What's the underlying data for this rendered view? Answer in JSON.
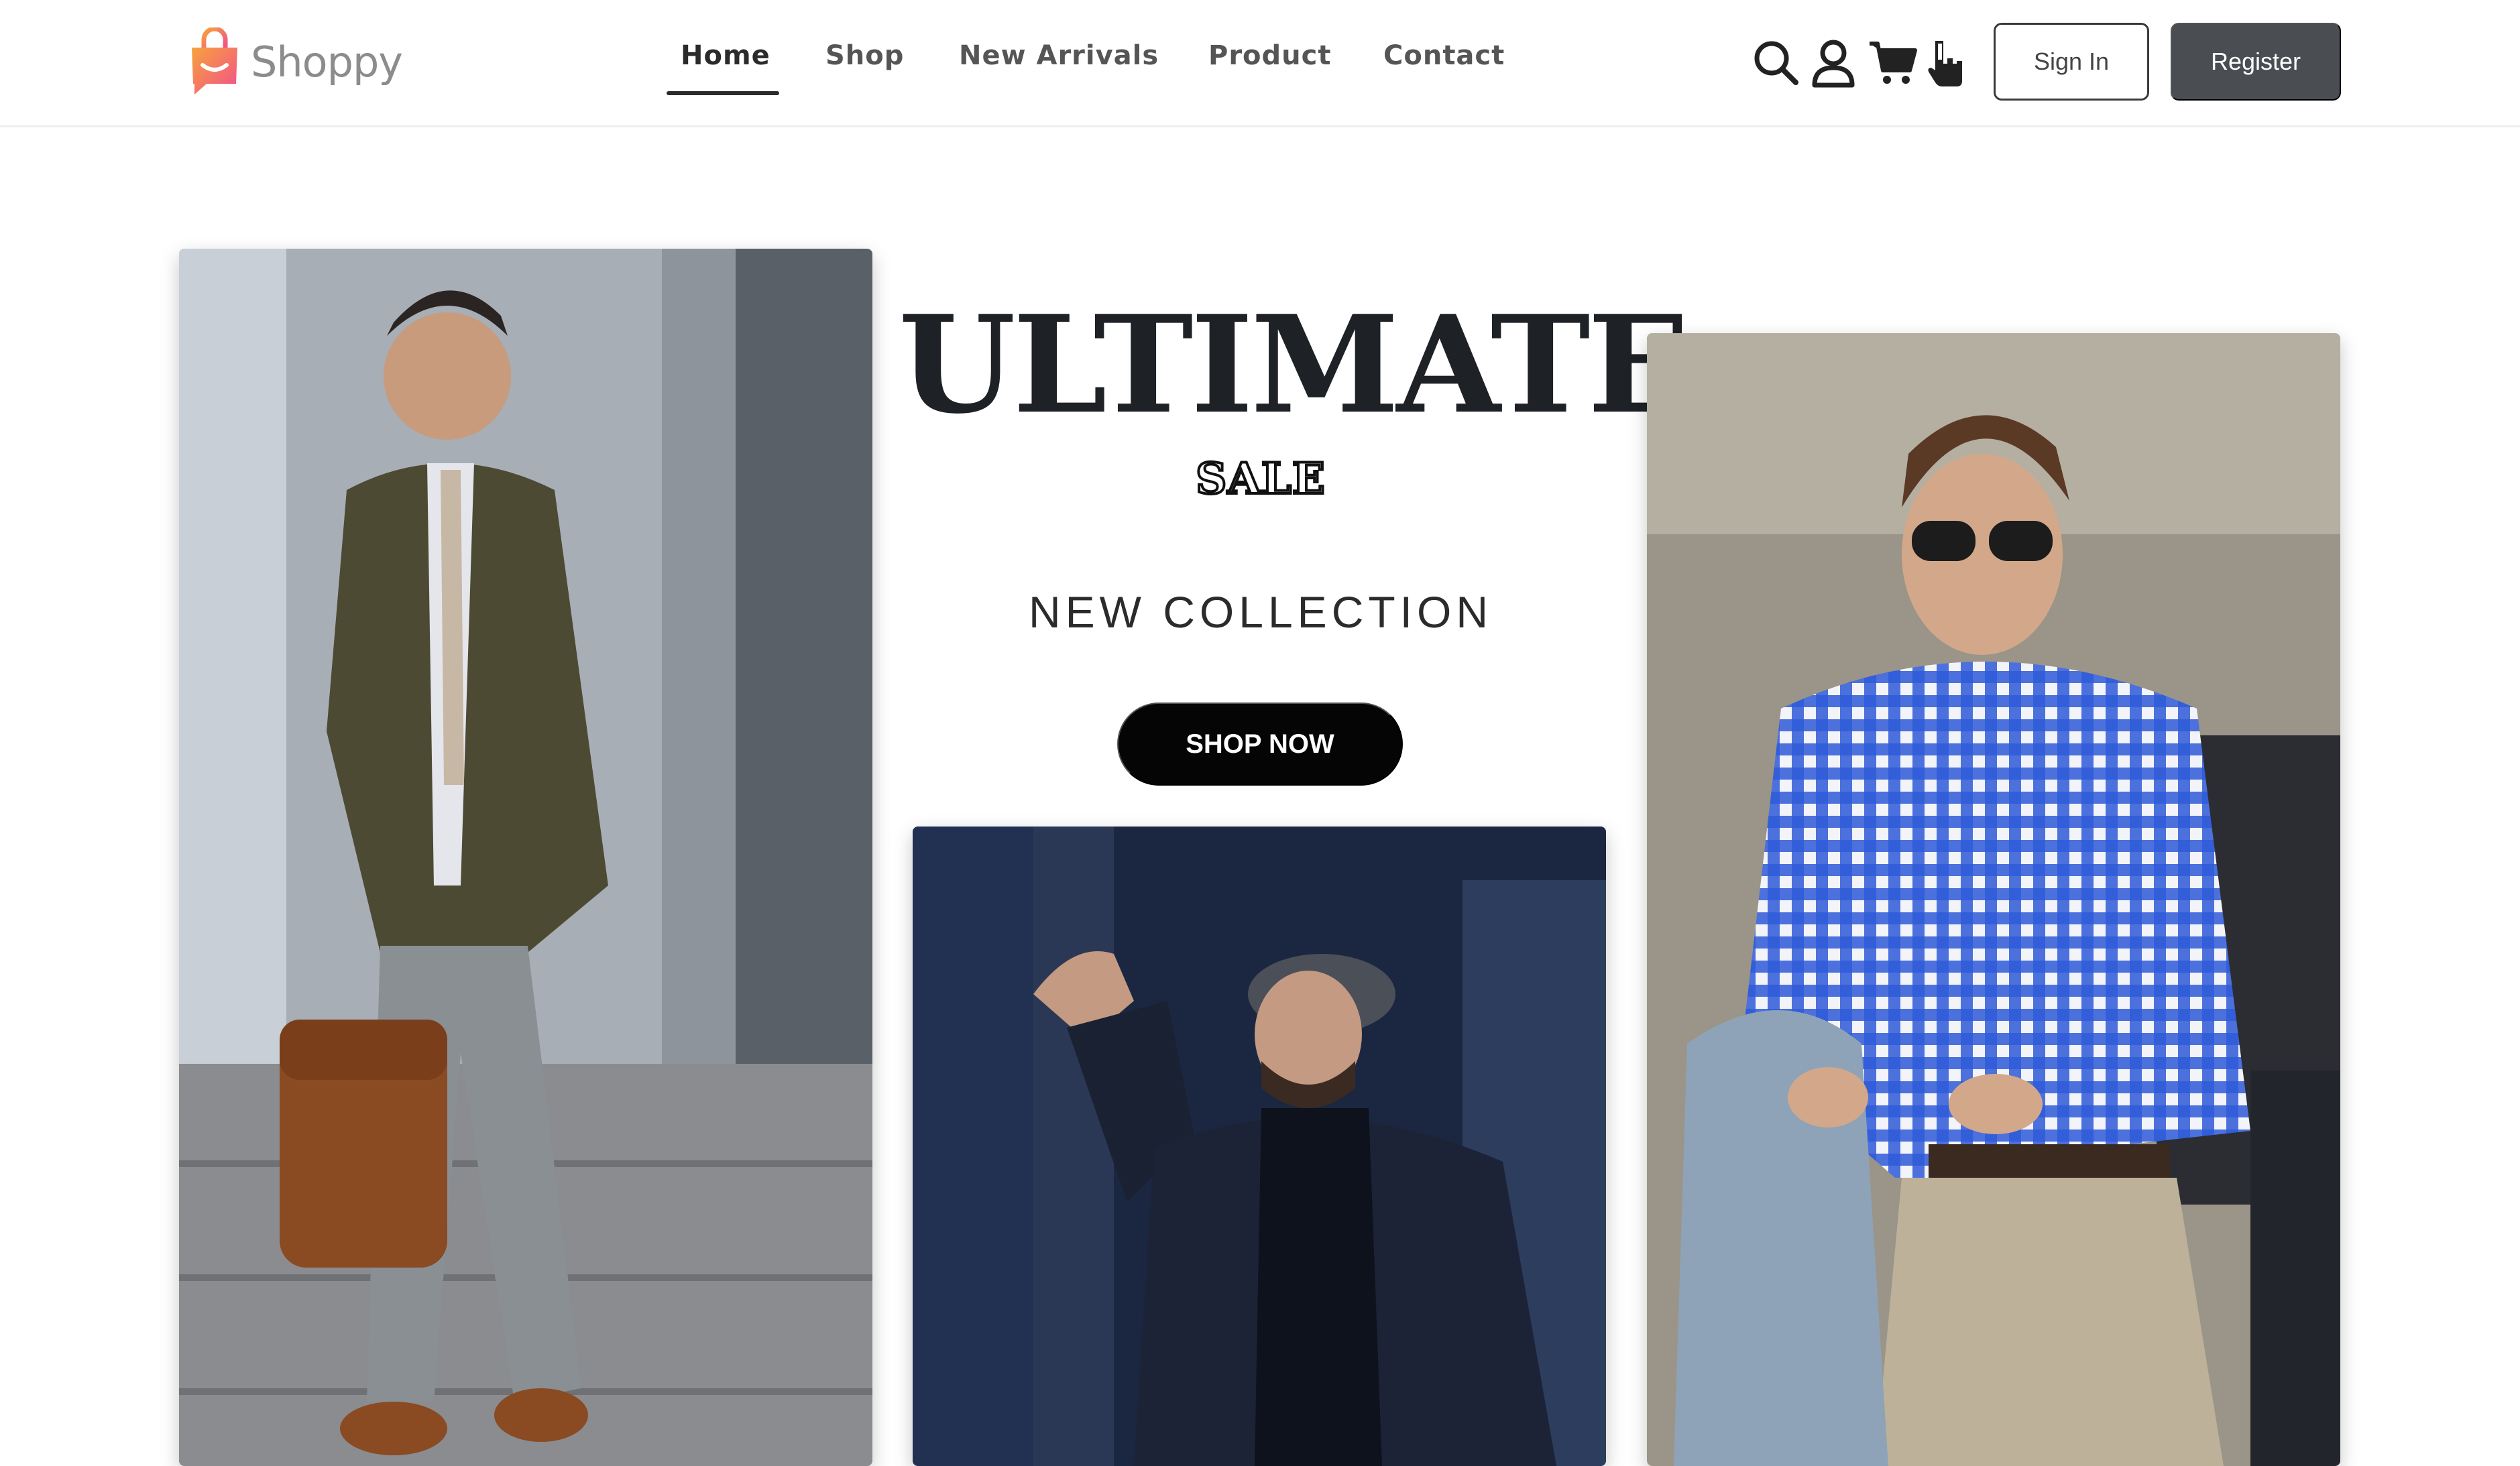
{
  "brand": {
    "name": "Shoppy",
    "logo_icon": "shopping-bag-chat-icon",
    "logo_colors": [
      "#f7a23b",
      "#f24f8c"
    ]
  },
  "nav": {
    "items": [
      {
        "label": "Home",
        "active": true
      },
      {
        "label": "Shop",
        "active": false
      },
      {
        "label": "New Arrivals",
        "active": false
      },
      {
        "label": "Product",
        "active": false
      },
      {
        "label": "Contact",
        "active": false
      }
    ]
  },
  "header_icons": [
    "search-icon",
    "user-icon",
    "cart-icon",
    "hand-pointer-icon"
  ],
  "auth": {
    "signin_label": "Sign In",
    "register_label": "Register"
  },
  "hero": {
    "title": "ULTIMATE",
    "subtitle": "SALE",
    "tagline": "NEW COLLECTION",
    "cta_label": "SHOP NOW"
  },
  "colors": {
    "nav_active": "#2b2b2b",
    "register_bg": "#4a4d52",
    "cta_bg": "#050505",
    "title": "#1e2126"
  }
}
